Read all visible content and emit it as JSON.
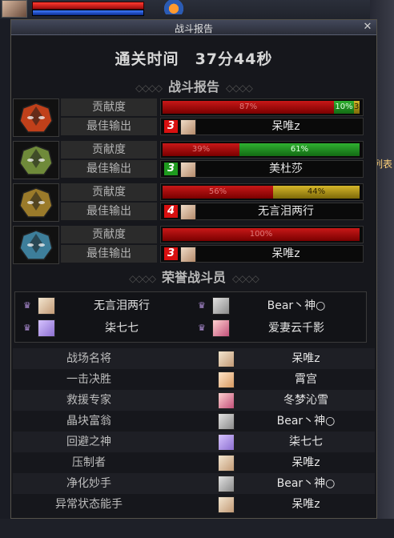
{
  "window": {
    "title": "战斗报告",
    "close_glyph": "✕"
  },
  "clear_time": {
    "label": "通关时间",
    "value": "37分44秒"
  },
  "report_section": {
    "title": "战斗报告",
    "ornament": "◇◇◇◇"
  },
  "row_labels": {
    "contribution": "贡献度",
    "best_output": "最佳输出"
  },
  "report_rows": [
    {
      "mask_icon": "red-flame-mask-icon",
      "mask_color": "#c0401a",
      "bars": [
        {
          "label": "87%",
          "pct": 87,
          "color": "red"
        },
        {
          "label": "10%",
          "pct": 10,
          "color": "green"
        },
        {
          "label": "3%",
          "pct": 3,
          "color": "gold"
        }
      ],
      "best": {
        "rank": "3",
        "rank_color": "red",
        "player": "呆唯z"
      }
    },
    {
      "mask_icon": "green-mask-icon",
      "mask_color": "#6f8a3a",
      "bars": [
        {
          "label": "39%",
          "pct": 39,
          "color": "red"
        },
        {
          "label": "61%",
          "pct": 61,
          "color": "green"
        }
      ],
      "best": {
        "rank": "3",
        "rank_color": "green",
        "player": "美杜莎"
      }
    },
    {
      "mask_icon": "gold-mask-icon",
      "mask_color": "#9a7a2a",
      "bars": [
        {
          "label": "56%",
          "pct": 56,
          "color": "red"
        },
        {
          "label": "44%",
          "pct": 44,
          "color": "gold"
        }
      ],
      "best": {
        "rank": "4",
        "rank_color": "red",
        "player": "无言泪两行"
      }
    },
    {
      "mask_icon": "blue-mask-icon",
      "mask_color": "#3d7e9a",
      "bars": [
        {
          "label": "100%",
          "pct": 100,
          "color": "red"
        }
      ],
      "best": {
        "rank": "3",
        "rank_color": "red",
        "player": "呆唯z"
      }
    }
  ],
  "honor_section": {
    "title": "荣誉战斗员",
    "ornament": "◇◇◇◇",
    "crown_icon": "crown-icon"
  },
  "honor_members": [
    {
      "name": "无言泪两行",
      "avatar": "a1"
    },
    {
      "name": "Bear丶神○",
      "avatar": "a5"
    },
    {
      "name": "柒七七",
      "avatar": "a2"
    },
    {
      "name": "爱妻云千影",
      "avatar": "a3"
    }
  ],
  "titles": [
    {
      "title": "战场名将",
      "player": "呆唯z",
      "avatar": "a1"
    },
    {
      "title": "一击决胜",
      "player": "霄宫",
      "avatar": "a4"
    },
    {
      "title": "救援专家",
      "player": "冬梦沁雪",
      "avatar": "a3"
    },
    {
      "title": "晶块富翁",
      "player": "Bear丶神○",
      "avatar": "a5"
    },
    {
      "title": "回避之神",
      "player": "柒七七",
      "avatar": "a2"
    },
    {
      "title": "压制者",
      "player": "呆唯z",
      "avatar": "a1"
    },
    {
      "title": "净化妙手",
      "player": "Bear丶神○",
      "avatar": "a5"
    },
    {
      "title": "异常状态能手",
      "player": "呆唯z",
      "avatar": "a1"
    }
  ],
  "side_text": "列表"
}
